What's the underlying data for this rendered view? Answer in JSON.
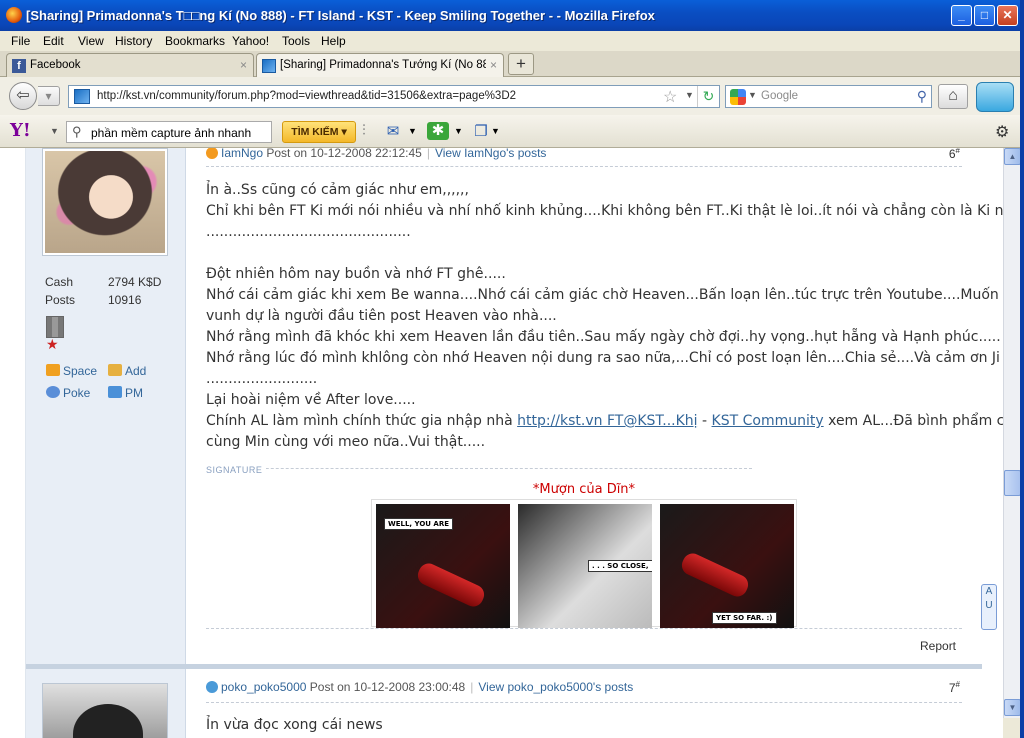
{
  "window": {
    "title": "[Sharing] Primadonna's T□□ng Kí (No 888) - FT Island - KST - Keep Smiling Together - - Mozilla Firefox",
    "minimize": "_",
    "maximize": "□",
    "close": "✕"
  },
  "menu": [
    "File",
    "Edit",
    "View",
    "History",
    "Bookmarks",
    "Yahoo!",
    "Tools",
    "Help"
  ],
  "tabs": [
    {
      "label": "Facebook",
      "close": "×"
    },
    {
      "label": "[Sharing] Primadonna's Tướng Kí (No 888...",
      "close": "×"
    }
  ],
  "new_tab": "+",
  "nav": {
    "url": "http://kst.vn/community/forum.php?mod=viewthread&tid=31506&extra=page%3D2",
    "search_placeholder": "Google"
  },
  "yahoo": {
    "logo": "Y!",
    "search_value": "phần mềm capture ảnh nhanh",
    "search_button": "TÌM KIẾM ▾"
  },
  "post1": {
    "author": "IamNgo",
    "posted": "Post on 10-12-2008 22:12:45",
    "view_posts": "View IamNgo's posts",
    "number": "6",
    "sup": "#",
    "stats": {
      "cash_label": "Cash",
      "cash_value": "2794 K$D",
      "posts_label": "Posts",
      "posts_value": "10916"
    },
    "links": {
      "space": "Space",
      "add": "Add",
      "poke": "Poke",
      "pm": "PM"
    },
    "lines": [
      "Ỉn à..Ss cũng có cảm giác như em,,,,,,",
      "Chỉ khi bên FT Ki mới nói nhiều và nhí nhố kinh khủng....Khi không bên FT..Ki thật lè loi..ít nói và chẳng còn là Ki nữa.....",
      "..............................................",
      "",
      "Đột nhiên hôm nay buồn và nhớ FT ghê.....",
      "Nhớ cái cảm giác khi xem Be wanna....Nhớ cái cảm giác chờ Heaven...Bấn loạn lên..túc trực trên Youtube....Muốn mình",
      "vunh dự là người đầu tiên post  Heaven vào nhà....",
      "Nhớ rằng mình đã khóc khi xem Heaven lần đầu tiên..Sau mấy ngày chờ đợi..hy vọng..hụt hẵng và Hạnh phúc.....",
      "Nhớ rằng lúc đó mình khlông còn nhớ Heaven nội dung ra sao nữa,...Chỉ có post loạn lên....Chia sẻ....Và cảm ơn Ji rối rít.....",
      ".........................",
      "Lại hoài niệm về After love.....",
      "Chính AL làm mình chính thức gia nhập nhà "
    ],
    "line11_link1": "http://kst.vn FT@KST...Khị",
    "line11_sep": " - ",
    "line11_link2": "KST Community",
    "line11_tail": " xem AL...Đã bình phẩm cùng Ủn",
    "line12": "cùng Min cùng với meo nữa..Vui thật.....",
    "signature_label": "SIGNATURE",
    "sig_title": "*Mượn của Dĩn*",
    "sig_captions": [
      "WELL, YOU ARE",
      ". . . SO CLOSE,",
      "YET SO FAR. :)"
    ],
    "report": "Report"
  },
  "post2": {
    "author": "poko_poko5000",
    "posted": "Post on 10-12-2008 23:00:48",
    "view_posts": "View poko_poko5000's posts",
    "number": "7",
    "sup": "#",
    "first_line": "Ỉn vừa đọc xong cái news"
  },
  "scroll": {
    "up": "▲",
    "down": "▼"
  },
  "sidetool": "A\nU"
}
